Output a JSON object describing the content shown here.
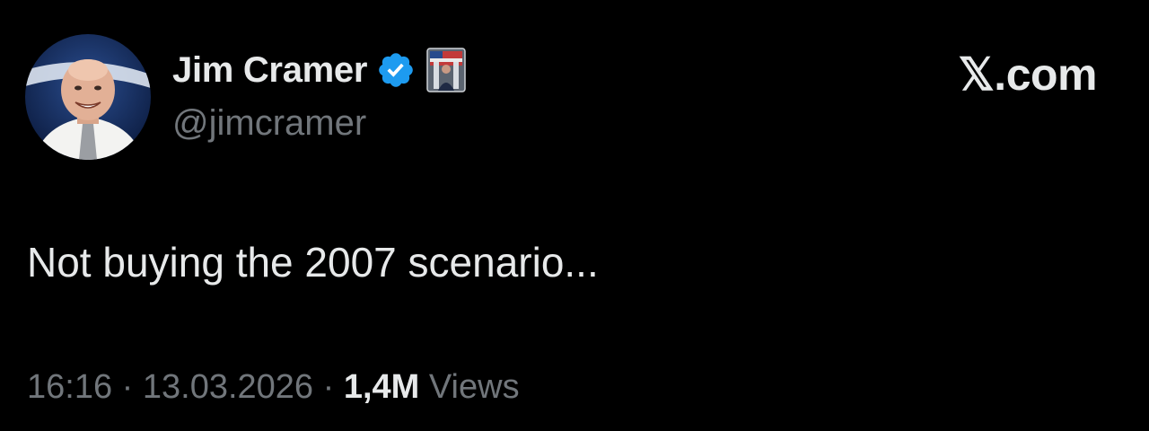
{
  "colors": {
    "background": "#000000",
    "primary_text": "#e7e9ea",
    "secondary_text": "#71767b",
    "verified_blue": "#1d9bf0"
  },
  "author": {
    "display_name": "Jim Cramer",
    "handle": "@jimcramer",
    "avatar_icon": "profile-photo",
    "verified_icon": "verified-badge-icon",
    "affiliate_icon": "affiliate-badge-photo"
  },
  "brand": {
    "label": "𝕏.com"
  },
  "tweet": {
    "text": "Not buying the 2007 scenario..."
  },
  "meta": {
    "time": "16:16",
    "separator": "·",
    "date": "13.03.2026",
    "views_count": "1,4M",
    "views_label": "Views"
  }
}
